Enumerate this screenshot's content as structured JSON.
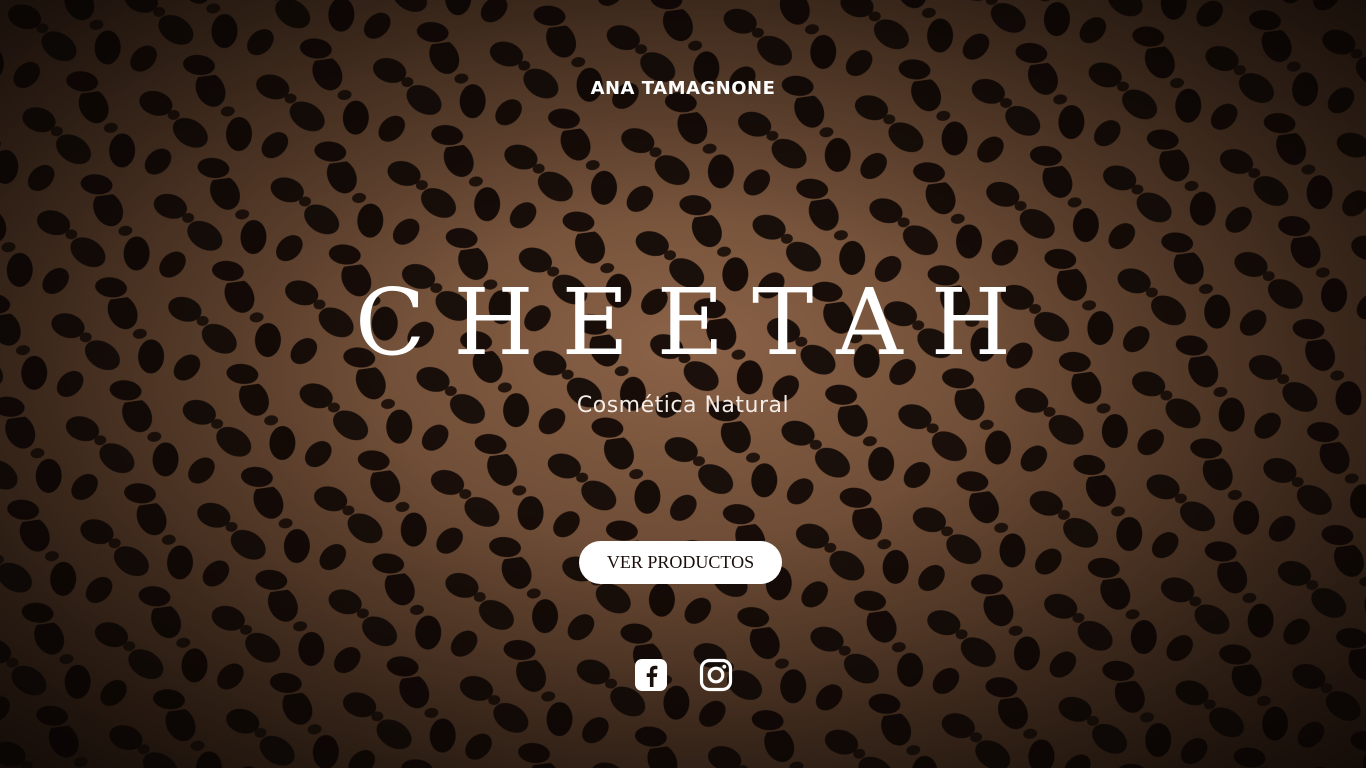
{
  "brand": {
    "top_name": "ANA TAMAGNONE",
    "title": "CHEETAH",
    "subtitle": "Cosmética Natural"
  },
  "cta": {
    "label": "VER PRODUCTOS"
  },
  "socials": [
    {
      "icon": "facebook-icon"
    },
    {
      "icon": "instagram-icon"
    }
  ],
  "colors": {
    "text": "#ffffff",
    "button_bg": "#ffffff",
    "button_text": "#1a0f0a",
    "fur_base": "#6b4a34",
    "spot": "#140b07"
  }
}
